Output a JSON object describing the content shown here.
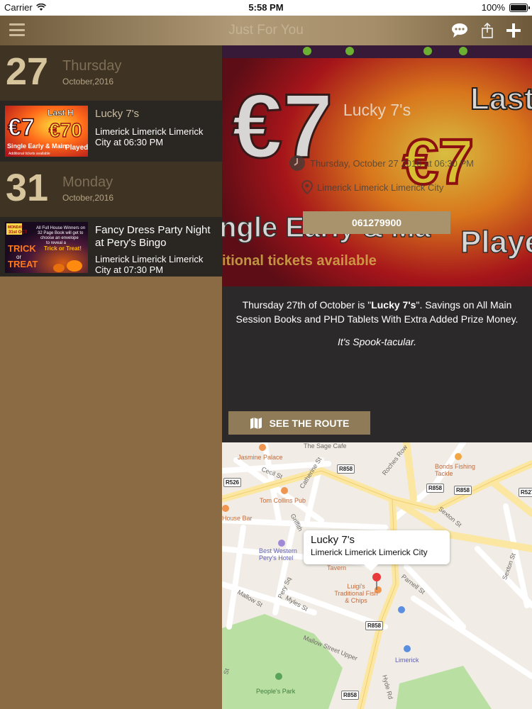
{
  "status_bar": {
    "carrier": "Carrier",
    "time": "5:58 PM",
    "battery_text": "100%",
    "battery_level": 1.0
  },
  "nav": {
    "title": "Just For You"
  },
  "list": {
    "groups": [
      {
        "day_number": "27",
        "weekday": "Thursday",
        "month_year": "October,2016",
        "events": [
          {
            "title": "Lucky 7's",
            "location": "Limerick Limerick Limerick City at 06:30 PM"
          }
        ]
      },
      {
        "day_number": "31",
        "weekday": "Monday",
        "month_year": "October,2016",
        "events": [
          {
            "title": "Fancy Dress Party Night at Pery's Bingo",
            "location": "Limerick Limerick Limerick City at 07:30 PM"
          }
        ]
      }
    ]
  },
  "detail": {
    "title": "Lucky 7's",
    "datetime": "Thursday, October 27 2016 at 06:30 PM",
    "location": "Limerick Limerick Limerick City",
    "phone": "061279900",
    "description_pre": "Thursday 27th of October is \"",
    "description_bold": "Lucky 7's",
    "description_post": "\".  Savings on All Main Session Books and PHD Tablets With Extra Added Prize Money.",
    "tagline": "It's Spook-tacular.",
    "route_button": "SEE THE ROUTE"
  },
  "map": {
    "callout_title": "Lucky 7's",
    "callout_subtitle": "Limerick Limerick Limerick City",
    "labels": {
      "sage_cafe": "The Sage Cafe",
      "jasmine_palace": "Jasmine Palace",
      "cecil_st": "Cecil St",
      "catherine_st": "Catherine St",
      "roches_row": "Roches Row",
      "bonds_fishing": "Bonds Fishing Tackle",
      "tom_collins": "Tom Collins Pub",
      "house_bar": "House Bar",
      "griffith": "Griffith",
      "sexton_st": "Sexton St",
      "sexton_st_n": "Sexton St",
      "best_western": "Best Western Pery's Hotel",
      "tavern": "Tavern",
      "luigis": "Luigi's Traditional Fish & Chips",
      "parnell_st": "Parnell St",
      "pery_sq": "Pery Sq",
      "mallow_st": "Mallow St",
      "myles_st": "Myles St",
      "mallow_street_upper": "Mallow Street Upper",
      "limerick": "Limerick",
      "peoples_park": "People's Park",
      "hyde_rd": "Hyde Rd",
      "st": "St"
    },
    "shields": {
      "r858_a": "R858",
      "r526": "R526",
      "r858_b": "R858",
      "r858_c": "R858",
      "r527": "R527",
      "r858_d": "R858",
      "r858_e": "R858"
    }
  }
}
